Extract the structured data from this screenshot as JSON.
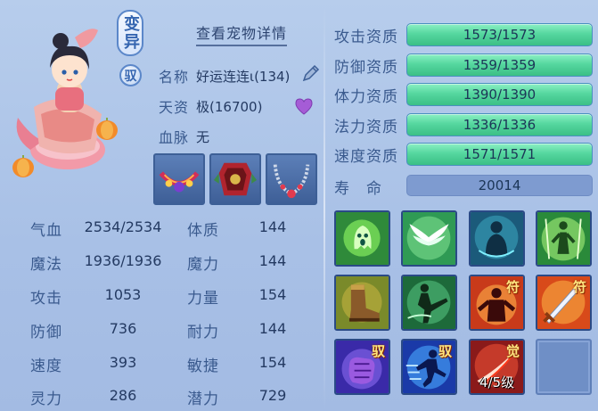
{
  "header": {
    "variant_badge": "变异",
    "tame_badge": "驭",
    "detail_link": "查看宠物详情"
  },
  "info": {
    "name_label": "名称",
    "name_value": "好运连连ι(134)",
    "aptitude_label": "天资",
    "aptitude_value": "极(16700)",
    "bloodline_label": "血脉",
    "bloodline_value": "无"
  },
  "equipment": [
    {
      "icon": "pet-collar-icon"
    },
    {
      "icon": "pet-armor-icon"
    },
    {
      "icon": "pet-necklace-icon"
    }
  ],
  "stats_left": [
    {
      "label": "气血",
      "value": "2534/2534"
    },
    {
      "label": "魔法",
      "value": "1936/1936"
    },
    {
      "label": "攻击",
      "value": "1053"
    },
    {
      "label": "防御",
      "value": "736"
    },
    {
      "label": "速度",
      "value": "393"
    },
    {
      "label": "灵力",
      "value": "286"
    }
  ],
  "stats_right": [
    {
      "label": "体质",
      "value": "144"
    },
    {
      "label": "魔力",
      "value": "144"
    },
    {
      "label": "力量",
      "value": "154"
    },
    {
      "label": "耐力",
      "value": "144"
    },
    {
      "label": "敏捷",
      "value": "154"
    },
    {
      "label": "潜力",
      "value": "729"
    }
  ],
  "aptitudes": [
    {
      "label": "攻击资质",
      "value": "1573/1573"
    },
    {
      "label": "防御资质",
      "value": "1359/1359"
    },
    {
      "label": "体力资质",
      "value": "1390/1390"
    },
    {
      "label": "法力资质",
      "value": "1336/1336"
    },
    {
      "label": "速度资质",
      "value": "1571/1571"
    }
  ],
  "lifespan": {
    "label": "寿　命",
    "value": "20014"
  },
  "skills": [
    {
      "icon": "green-ghost-skill-icon",
      "mark": ""
    },
    {
      "icon": "white-wings-skill-icon",
      "mark": ""
    },
    {
      "icon": "shadow-figure-skill-icon",
      "mark": ""
    },
    {
      "icon": "green-aura-figure-skill-icon",
      "mark": ""
    },
    {
      "icon": "boot-skill-icon",
      "mark": ""
    },
    {
      "icon": "kick-skill-icon",
      "mark": ""
    },
    {
      "icon": "red-figure-skill-icon",
      "mark": "符"
    },
    {
      "icon": "sword-skill-icon",
      "mark": "符"
    },
    {
      "icon": "purple-fist-skill-icon",
      "mark": "驭"
    },
    {
      "icon": "blue-runner-skill-icon",
      "mark": "驭"
    },
    {
      "icon": "red-slash-skill-icon",
      "mark": "觉",
      "level": "4/5级"
    },
    {
      "icon": "empty-skill-slot",
      "mark": ""
    }
  ],
  "colors": {
    "background": "#b7cdec",
    "aptitude_bar": "#56d79f",
    "lifespan_bar": "#7e9bd0",
    "text_label": "#3a5a8e"
  }
}
